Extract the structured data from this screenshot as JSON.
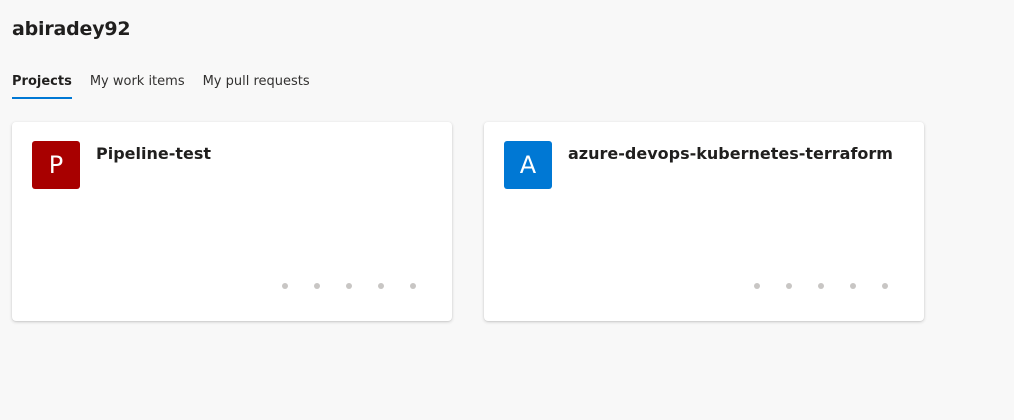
{
  "org": {
    "title": "abiradey92"
  },
  "tabs": [
    {
      "label": "Projects",
      "selected": true
    },
    {
      "label": "My work items",
      "selected": false
    },
    {
      "label": "My pull requests",
      "selected": false
    }
  ],
  "projects": [
    {
      "letter": "P",
      "name": "Pipeline-test",
      "color": "#a80000",
      "dot_count": 5
    },
    {
      "letter": "A",
      "name": "azure-devops-kubernetes-terraform",
      "color": "#0078d4",
      "dot_count": 5
    }
  ],
  "colors": {
    "accent": "#0078d4",
    "background": "#f8f8f8",
    "dot": "#c8c6c4"
  }
}
